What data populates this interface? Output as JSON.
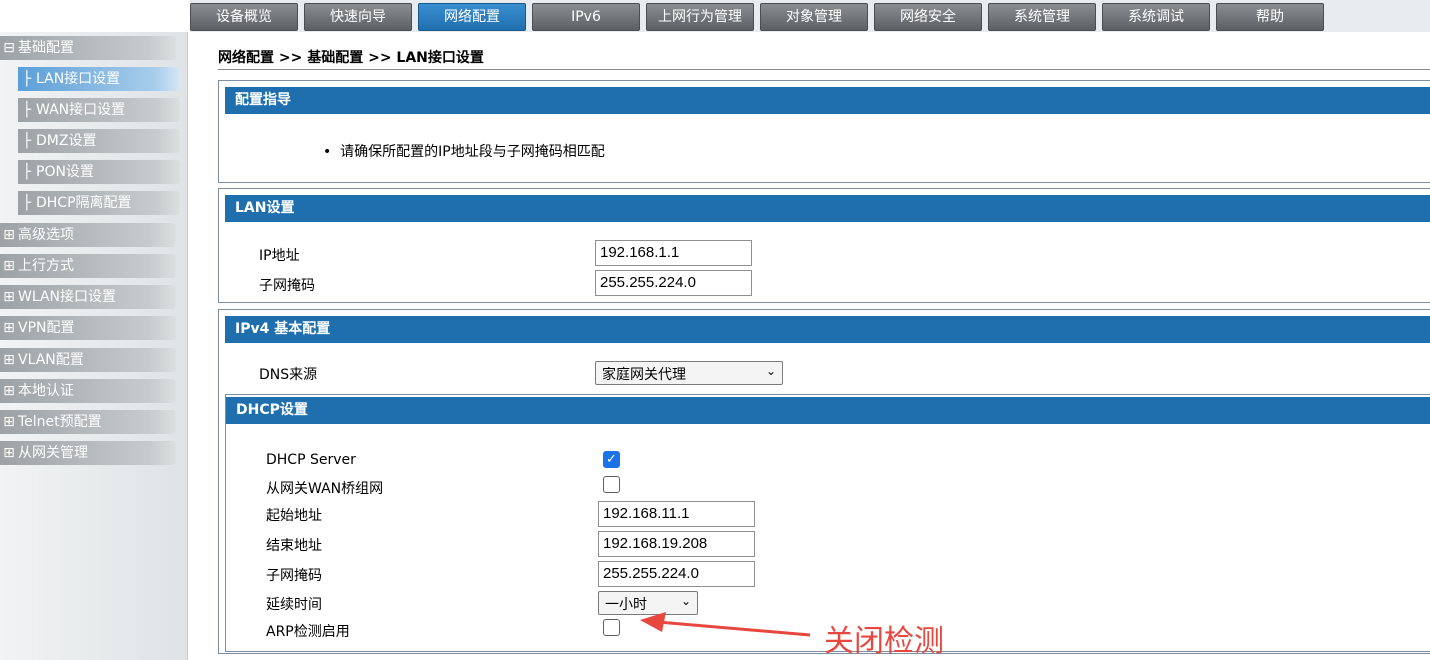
{
  "topnav": {
    "tabs": [
      "设备概览",
      "快速向导",
      "网络配置",
      "IPv6",
      "上网行为管理",
      "对象管理",
      "网络安全",
      "系统管理",
      "系统调试",
      "帮助"
    ],
    "active_index": 2,
    "active_color": "#1f6fae"
  },
  "sidebar": {
    "group_open": {
      "symbol": "⊟",
      "label": "基础配置"
    },
    "sub_items": [
      {
        "symbol": "├",
        "label": "LAN接口设置",
        "active": true
      },
      {
        "symbol": "├",
        "label": "WAN接口设置"
      },
      {
        "symbol": "├",
        "label": "DMZ设置"
      },
      {
        "symbol": "├",
        "label": "PON设置"
      },
      {
        "symbol": "├",
        "label": "DHCP隔离配置"
      }
    ],
    "groups": [
      {
        "symbol": "⊞",
        "label": "高级选项"
      },
      {
        "symbol": "⊞",
        "label": "上行方式"
      },
      {
        "symbol": "⊞",
        "label": "WLAN接口设置"
      },
      {
        "symbol": "⊞",
        "label": "VPN配置"
      },
      {
        "symbol": "⊞",
        "label": "VLAN配置"
      },
      {
        "symbol": "⊞",
        "label": "本地认证"
      },
      {
        "symbol": "⊞",
        "label": "Telnet预配置"
      },
      {
        "symbol": "⊞",
        "label": "从网关管理"
      }
    ]
  },
  "breadcrumb": "网络配置 >> 基础配置 >> LAN接口设置",
  "guide": {
    "title": "配置指导",
    "bullet": "请确保所配置的IP地址段与子网掩码相匹配"
  },
  "lan": {
    "title": "LAN设置",
    "ip_label": "IP地址",
    "ip_value": "192.168.1.1",
    "mask_label": "子网掩码",
    "mask_value": "255.255.224.0"
  },
  "ipv4": {
    "title": "IPv4 基本配置",
    "dns_label": "DNS来源",
    "dns_value": "家庭网关代理"
  },
  "dhcp": {
    "title": "DHCP设置",
    "server_label": "DHCP Server",
    "server_checked": true,
    "bridge_label": "从网关WAN桥组网",
    "bridge_checked": false,
    "start_label": "起始地址",
    "start_value": "192.168.11.1",
    "end_label": "结束地址",
    "end_value": "192.168.19.208",
    "mask_label": "子网掩码",
    "mask_value": "255.255.224.0",
    "lease_label": "延续时间",
    "lease_value": "一小时",
    "arp_label": "ARP检测启用",
    "arp_checked": false
  },
  "annotation": {
    "text": "关闭检测",
    "color": "#e8473f"
  }
}
